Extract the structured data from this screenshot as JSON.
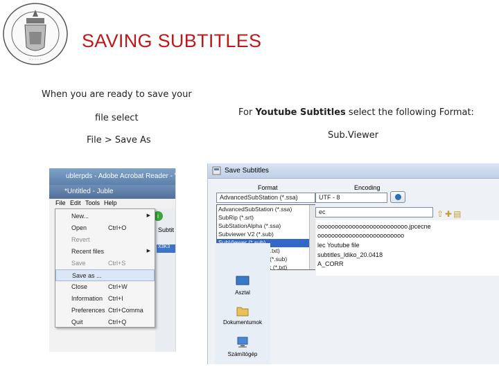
{
  "slide": {
    "title": "SAVING SUBTITLES",
    "left_text_line1": "When you are ready to save your",
    "left_text_line2": "file select",
    "left_text_line3": "File > Save As",
    "right_text_prefix": "For ",
    "right_text_bold": "Youtube Subtitles",
    "right_text_suffix": " select the following Format:",
    "right_format": "Sub.Viewer"
  },
  "jubler_window": {
    "title_back": "ublerpds - Adobe Acrobat Reader - Vi",
    "title_front": "*Untitled - Juble",
    "menubar": [
      "File",
      "Edit",
      "Tools",
      "Help"
    ],
    "file_menu": [
      {
        "label": "New...",
        "shortcut": "",
        "submenu": true,
        "disabled": false
      },
      {
        "label": "Open",
        "shortcut": "Ctrl+O",
        "submenu": false,
        "disabled": false
      },
      {
        "label": "Revert",
        "shortcut": "",
        "submenu": false,
        "disabled": true
      },
      {
        "label": "Recent files",
        "shortcut": "",
        "submenu": true,
        "disabled": false
      },
      {
        "label": "Save",
        "shortcut": "Ctrl+S",
        "submenu": false,
        "disabled": true
      },
      {
        "label": "Save as ...",
        "shortcut": "",
        "submenu": false,
        "disabled": false,
        "highlighted": true
      },
      {
        "label": "Close",
        "shortcut": "Ctrl+W",
        "submenu": false,
        "disabled": false
      },
      {
        "label": "Information",
        "shortcut": "Ctrl+I",
        "submenu": false,
        "disabled": false
      },
      {
        "label": "Preferences",
        "shortcut": "Ctrl+Comma",
        "submenu": false,
        "disabled": false
      },
      {
        "label": "Quit",
        "shortcut": "Ctrl+Q",
        "submenu": false,
        "disabled": false
      }
    ],
    "side_tab": "Subtit",
    "blue_cell": "X3K3"
  },
  "save_dialog": {
    "title": "Save Subtitles",
    "format_label": "Format",
    "encoding_label": "Encoding",
    "format_selected": "AdvancedSubStation  (*.ssa)",
    "encoding_selected": "UTF - 8",
    "type_combo": "ec",
    "format_options": [
      "AdvancedSubStation  (*.ssa)",
      "SubRip  (*.srt)",
      "SubStationAlpha  (*.ssa)",
      "Subviewer V2  (*.sub)",
      "SubViewer  (*.sub)",
      "MPL2 Subtitle file  (*.txt)",
      "MicroDVD SUB file  (*.sub)",
      "Quicktime TextTrack  (*.txt)"
    ],
    "selected_option_index": 4,
    "files": [
      "oooooooooooooooooooooooooo.jpcecne",
      "ooooooooooooooooooooooooo",
      "lec Youtube file",
      "subtitles_ldiko_20.0418",
      "A_CORR"
    ],
    "places": [
      "Asztal",
      "Dokumentumok",
      "Számítógép"
    ]
  },
  "colors": {
    "title": "#c01818",
    "selection": "#3367c5"
  }
}
